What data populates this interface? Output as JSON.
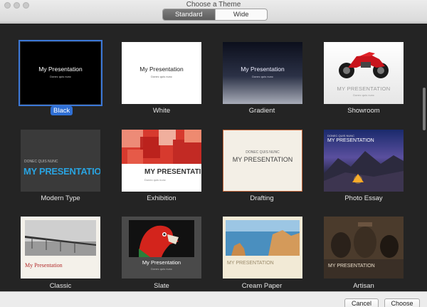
{
  "window": {
    "title": "Choose a Theme"
  },
  "segmented": {
    "standard": "Standard",
    "wide": "Wide"
  },
  "themes": [
    {
      "name": "Black",
      "thumb_title": "My Presentation",
      "thumb_sub": "Donec quis nunc"
    },
    {
      "name": "White",
      "thumb_title": "My Presentation",
      "thumb_sub": "Donec quis nunc"
    },
    {
      "name": "Gradient",
      "thumb_title": "My Presentation",
      "thumb_sub": "Donec quis nunc"
    },
    {
      "name": "Showroom",
      "thumb_title": "MY PRESENTATION",
      "thumb_sub": "Donec quis nunc"
    },
    {
      "name": "Modern Type",
      "thumb_title": "MY PRESENTATION",
      "thumb_sub": "DONEC QUIS NUNC"
    },
    {
      "name": "Exhibition",
      "thumb_title": "MY PRESENTATION",
      "thumb_sub": "Donec quis nunc"
    },
    {
      "name": "Drafting",
      "thumb_title": "MY PRESENTATION",
      "thumb_sub": "DONEC QUIS NUNC"
    },
    {
      "name": "Photo Essay",
      "thumb_title": "MY PRESENTATION",
      "thumb_sub": "DONEC QUIS NUNC"
    },
    {
      "name": "Classic",
      "thumb_title": "My Presentation",
      "thumb_sub": ""
    },
    {
      "name": "Slate",
      "thumb_title": "My Presentation",
      "thumb_sub": "Donec quis nunc"
    },
    {
      "name": "Cream Paper",
      "thumb_title": "MY PRESENTATION",
      "thumb_sub": ""
    },
    {
      "name": "Artisan",
      "thumb_title": "MY PRESENTATION",
      "thumb_sub": ""
    }
  ],
  "buttons": {
    "cancel": "Cancel",
    "choose": "Choose"
  },
  "colors": {
    "selection": "#2f6fd4",
    "gallery_bg": "#242424"
  }
}
